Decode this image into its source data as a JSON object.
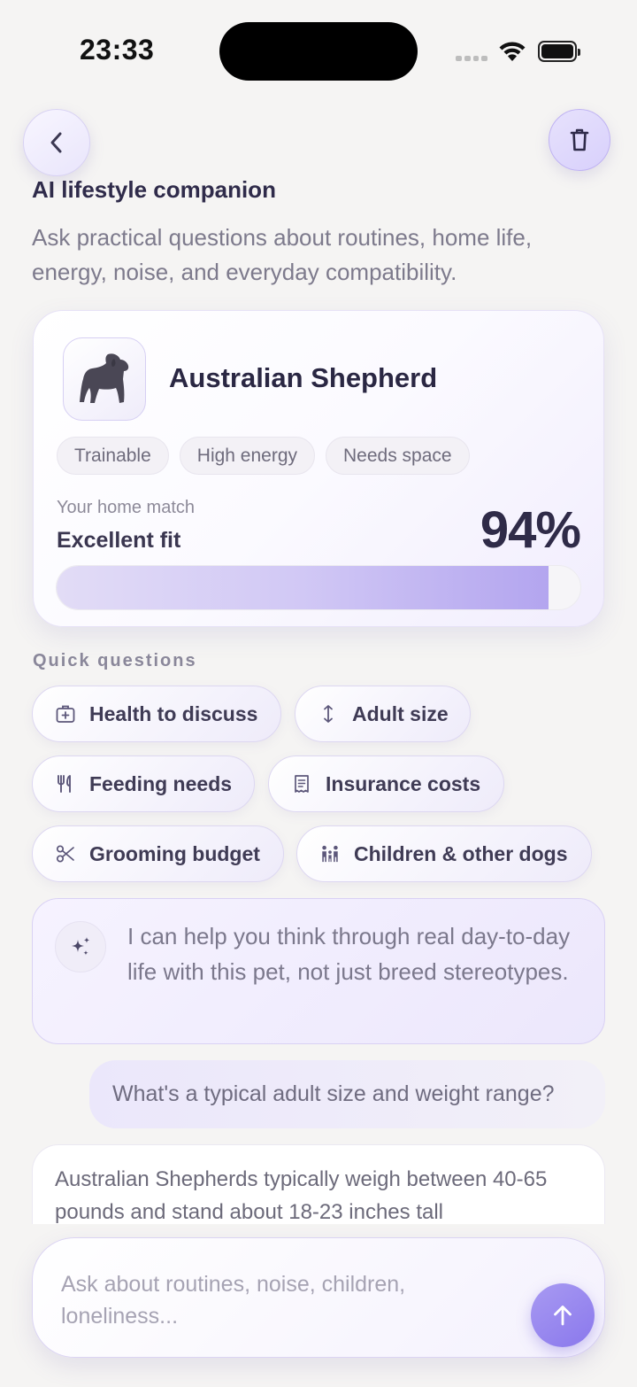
{
  "status_bar": {
    "time": "23:33"
  },
  "header": {
    "back_icon": "chevron-left-icon",
    "trash_icon": "trash-icon",
    "title": "AI lifestyle companion",
    "subtitle": "Ask practical questions about routines, home life, energy, noise, and everyday compatibility."
  },
  "breed_card": {
    "name": "Australian Shepherd",
    "avatar_icon": "dog-silhouette-icon",
    "tags": [
      "Trainable",
      "High energy",
      "Needs space"
    ],
    "match_label": "Your home match",
    "match_value": "Excellent fit",
    "match_percent_text": "94%",
    "match_fraction": 0.94
  },
  "quick_questions": {
    "title": "Quick questions",
    "items": [
      {
        "label": "Health to discuss",
        "icon": "medical-kit-icon"
      },
      {
        "label": "Adult size",
        "icon": "vertical-arrows-icon"
      },
      {
        "label": "Feeding needs",
        "icon": "fork-knife-icon"
      },
      {
        "label": "Insurance costs",
        "icon": "receipt-icon"
      },
      {
        "label": "Grooming budget",
        "icon": "scissors-icon"
      },
      {
        "label": "Children & other dogs",
        "icon": "family-icon"
      }
    ]
  },
  "chat": {
    "assistant_icon": "sparkles-icon",
    "assistant_intro": "I can help you think through real day-to-day life with this pet, not just breed stereotypes.",
    "user_message": "What's a typical adult size and weight range?",
    "assistant_reply": "Australian Shepherds typically weigh between 40-65 pounds and stand about 18-23 inches tall"
  },
  "composer": {
    "placeholder": "Ask about routines, noise, children, loneliness...",
    "send_icon": "arrow-up-icon"
  },
  "colors": {
    "accent": "#8a78ec",
    "background": "#f5f4f3",
    "text_primary": "#2d2a45"
  }
}
